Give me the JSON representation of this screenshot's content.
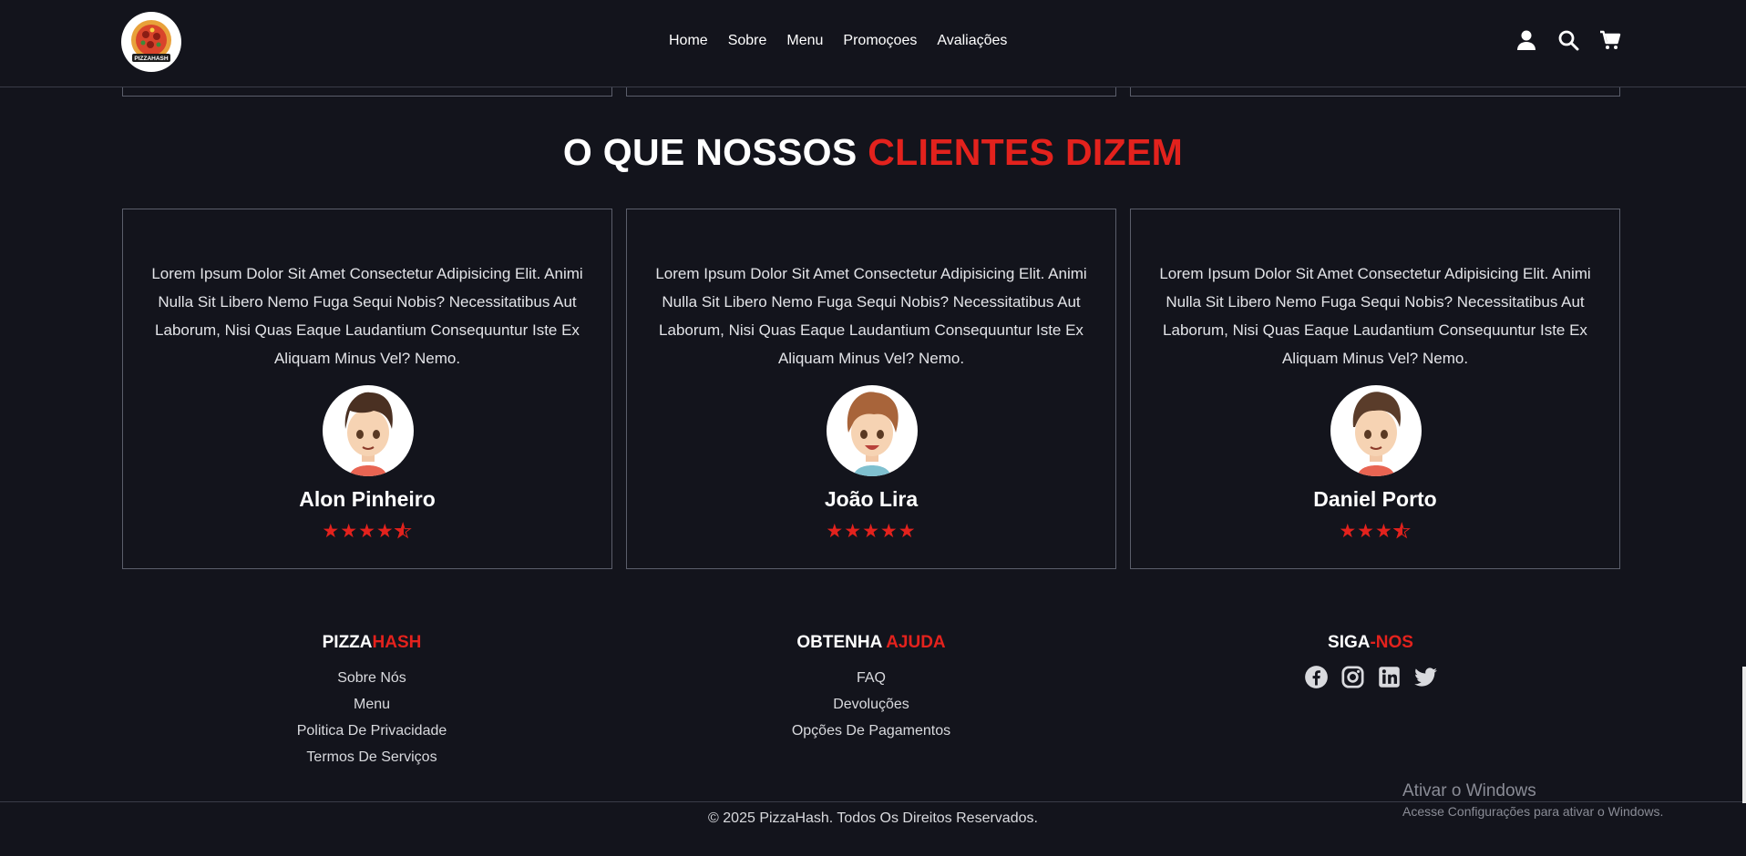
{
  "header": {
    "logo_text": "PIZZAHASH",
    "nav": [
      "Home",
      "Sobre",
      "Menu",
      "Promoçoes",
      "Avaliações"
    ],
    "icons": [
      "user-icon",
      "search-icon",
      "cart-icon"
    ]
  },
  "testimonials": {
    "title_white": "O QUE NOSSOS",
    "title_red": "CLIENTES DIZEM",
    "cards": [
      {
        "quote": "Lorem Ipsum Dolor Sit Amet Consectetur Adipisicing Elit. Animi Nulla Sit Libero Nemo Fuga Sequi Nobis? Necessitatibus Aut Laborum, Nisi Quas Eaque Laudantium Consequuntur Iste Ex Aliquam Minus Vel? Nemo.",
        "name": "Alon Pinheiro",
        "rating": 4.5
      },
      {
        "quote": "Lorem Ipsum Dolor Sit Amet Consectetur Adipisicing Elit. Animi Nulla Sit Libero Nemo Fuga Sequi Nobis? Necessitatibus Aut Laborum, Nisi Quas Eaque Laudantium Consequuntur Iste Ex Aliquam Minus Vel? Nemo.",
        "name": "João Lira",
        "rating": 5
      },
      {
        "quote": "Lorem Ipsum Dolor Sit Amet Consectetur Adipisicing Elit. Animi Nulla Sit Libero Nemo Fuga Sequi Nobis? Necessitatibus Aut Laborum, Nisi Quas Eaque Laudantium Consequuntur Iste Ex Aliquam Minus Vel? Nemo.",
        "name": "Daniel Porto",
        "rating": 3.5
      }
    ]
  },
  "footer": {
    "col1": {
      "title_white": "PIZZA",
      "title_red": "HASH",
      "links": [
        "Sobre Nós",
        "Menu",
        "Politica De Privacidade",
        "Termos De Serviços"
      ]
    },
    "col2": {
      "title_white": "OBTENHA",
      "title_red": "AJUDA",
      "links": [
        "FAQ",
        "Devoluções",
        "Opções De Pagamentos"
      ]
    },
    "col3": {
      "title_white": "SIGA",
      "title_red": "-NOS",
      "social": [
        "facebook-icon",
        "instagram-icon",
        "linkedin-icon",
        "twitter-icon"
      ]
    },
    "copyright": "© 2025 PizzaHash. Todos Os Direitos Reservados."
  },
  "windows_watermark": {
    "title": "Ativar o Windows",
    "subtitle": "Acesse Configurações para ativar o Windows."
  },
  "colors": {
    "background": "#13141c",
    "accent": "#e3221d",
    "border": "#5b5e6b"
  }
}
